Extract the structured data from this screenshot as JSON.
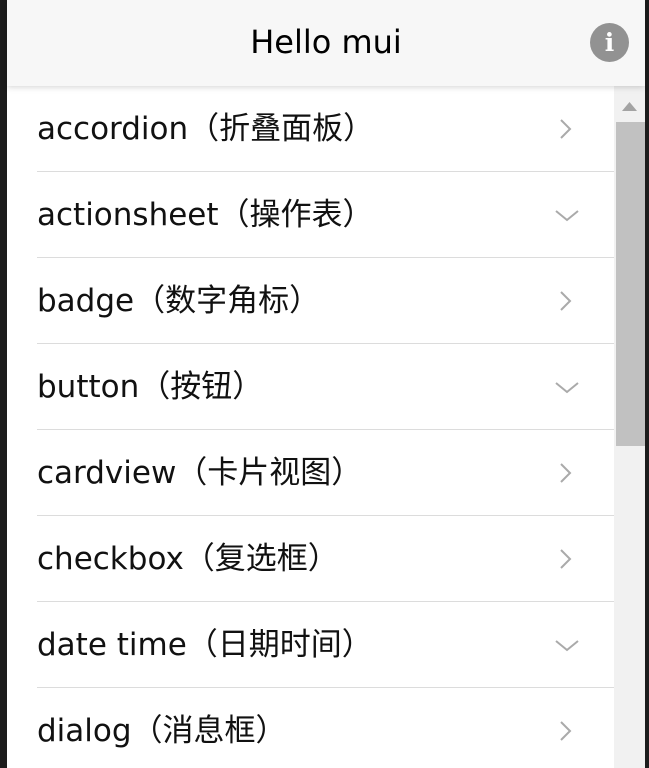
{
  "header": {
    "title": "Hello mui",
    "info_icon": "i"
  },
  "list": {
    "items": [
      {
        "label": "accordion（折叠面板）",
        "icon": "chevron-right-icon"
      },
      {
        "label": "actionsheet（操作表）",
        "icon": "chevron-down-icon"
      },
      {
        "label": "badge（数字角标）",
        "icon": "chevron-right-icon"
      },
      {
        "label": "button（按钮）",
        "icon": "chevron-down-icon"
      },
      {
        "label": "cardview（卡片视图）",
        "icon": "chevron-right-icon"
      },
      {
        "label": "checkbox（复选框）",
        "icon": "chevron-right-icon"
      },
      {
        "label": "date time（日期时间）",
        "icon": "chevron-down-icon"
      },
      {
        "label": "dialog（消息框）",
        "icon": "chevron-right-icon"
      }
    ]
  },
  "colors": {
    "header_bg": "#f7f7f7",
    "info_button": "#929292",
    "divider": "#dcdcdc",
    "chevron": "#aaaaaa",
    "scrollbar_track": "#f1f1f1",
    "scrollbar_thumb": "#c1c1c1"
  }
}
